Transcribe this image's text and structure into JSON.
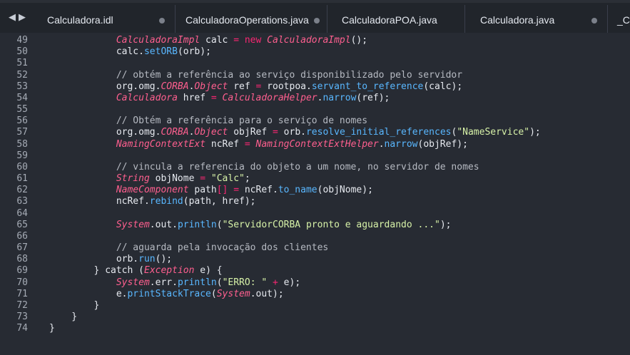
{
  "tabs": [
    {
      "label": "Calculadora.idl",
      "dirty": true
    },
    {
      "label": "CalculadoraOperations.java",
      "dirty": true
    },
    {
      "label": "CalculadoraPOA.java",
      "dirty": false
    },
    {
      "label": "Calculadora.java",
      "dirty": true
    },
    {
      "label": "_Ca",
      "dirty": false
    }
  ],
  "navigation": {
    "back_icon": "◀",
    "forward_icon": "▶"
  },
  "code_lines": [
    {
      "number": "49",
      "indent": 12,
      "tokens": [
        {
          "text": "CalculadoraImpl",
          "type": "type"
        },
        {
          "text": " calc ",
          "type": "plain"
        },
        {
          "text": "=",
          "type": "op"
        },
        {
          "text": " new ",
          "type": "keyword"
        },
        {
          "text": "CalculadoraImpl",
          "type": "type"
        },
        {
          "text": "();",
          "type": "plain"
        }
      ]
    },
    {
      "number": "50",
      "indent": 12,
      "tokens": [
        {
          "text": "calc.",
          "type": "plain"
        },
        {
          "text": "setORB",
          "type": "method"
        },
        {
          "text": "(orb);",
          "type": "plain"
        }
      ]
    },
    {
      "number": "51",
      "indent": 0,
      "tokens": []
    },
    {
      "number": "52",
      "indent": 12,
      "tokens": [
        {
          "text": "// obtém a referência ao serviço disponibilizado pelo servidor",
          "type": "comment"
        }
      ]
    },
    {
      "number": "53",
      "indent": 12,
      "tokens": [
        {
          "text": "org.omg.",
          "type": "plain"
        },
        {
          "text": "CORBA",
          "type": "type"
        },
        {
          "text": ".",
          "type": "plain"
        },
        {
          "text": "Object",
          "type": "type"
        },
        {
          "text": " ref ",
          "type": "plain"
        },
        {
          "text": "=",
          "type": "op"
        },
        {
          "text": " rootpoa.",
          "type": "plain"
        },
        {
          "text": "servant_to_reference",
          "type": "method"
        },
        {
          "text": "(calc);",
          "type": "plain"
        }
      ]
    },
    {
      "number": "54",
      "indent": 12,
      "tokens": [
        {
          "text": "Calculadora",
          "type": "type"
        },
        {
          "text": " href ",
          "type": "plain"
        },
        {
          "text": "=",
          "type": "op"
        },
        {
          "text": " ",
          "type": "plain"
        },
        {
          "text": "CalculadoraHelper",
          "type": "type"
        },
        {
          "text": ".",
          "type": "plain"
        },
        {
          "text": "narrow",
          "type": "method"
        },
        {
          "text": "(ref);",
          "type": "plain"
        }
      ]
    },
    {
      "number": "55",
      "indent": 0,
      "tokens": []
    },
    {
      "number": "56",
      "indent": 12,
      "tokens": [
        {
          "text": "// Obtém a referência para o serviço de nomes",
          "type": "comment"
        }
      ]
    },
    {
      "number": "57",
      "indent": 12,
      "tokens": [
        {
          "text": "org.omg.",
          "type": "plain"
        },
        {
          "text": "CORBA",
          "type": "type"
        },
        {
          "text": ".",
          "type": "plain"
        },
        {
          "text": "Object",
          "type": "type"
        },
        {
          "text": " objRef ",
          "type": "plain"
        },
        {
          "text": "=",
          "type": "op"
        },
        {
          "text": " orb.",
          "type": "plain"
        },
        {
          "text": "resolve_initial_references",
          "type": "method"
        },
        {
          "text": "(",
          "type": "plain"
        },
        {
          "text": "\"NameService\"",
          "type": "string"
        },
        {
          "text": ");",
          "type": "plain"
        }
      ]
    },
    {
      "number": "58",
      "indent": 12,
      "tokens": [
        {
          "text": "NamingContextExt",
          "type": "type"
        },
        {
          "text": " ncRef ",
          "type": "plain"
        },
        {
          "text": "=",
          "type": "op"
        },
        {
          "text": " ",
          "type": "plain"
        },
        {
          "text": "NamingContextExtHelper",
          "type": "type"
        },
        {
          "text": ".",
          "type": "plain"
        },
        {
          "text": "narrow",
          "type": "method"
        },
        {
          "text": "(objRef);",
          "type": "plain"
        }
      ]
    },
    {
      "number": "59",
      "indent": 0,
      "tokens": []
    },
    {
      "number": "60",
      "indent": 12,
      "tokens": [
        {
          "text": "// vincula a referencia do objeto a um nome, no servidor de nomes",
          "type": "comment"
        }
      ]
    },
    {
      "number": "61",
      "indent": 12,
      "tokens": [
        {
          "text": "String",
          "type": "type"
        },
        {
          "text": " objNome ",
          "type": "plain"
        },
        {
          "text": "=",
          "type": "op"
        },
        {
          "text": " ",
          "type": "plain"
        },
        {
          "text": "\"Calc\"",
          "type": "string"
        },
        {
          "text": ";",
          "type": "plain"
        }
      ]
    },
    {
      "number": "62",
      "indent": 12,
      "tokens": [
        {
          "text": "NameComponent",
          "type": "type"
        },
        {
          "text": " path",
          "type": "plain"
        },
        {
          "text": "[]",
          "type": "bracket"
        },
        {
          "text": " ",
          "type": "plain"
        },
        {
          "text": "=",
          "type": "op"
        },
        {
          "text": " ncRef.",
          "type": "plain"
        },
        {
          "text": "to_name",
          "type": "method"
        },
        {
          "text": "(objNome);",
          "type": "plain"
        }
      ]
    },
    {
      "number": "63",
      "indent": 12,
      "tokens": [
        {
          "text": "ncRef.",
          "type": "plain"
        },
        {
          "text": "rebind",
          "type": "method"
        },
        {
          "text": "(path, href);",
          "type": "plain"
        }
      ]
    },
    {
      "number": "64",
      "indent": 0,
      "tokens": []
    },
    {
      "number": "65",
      "indent": 12,
      "tokens": [
        {
          "text": "System",
          "type": "type"
        },
        {
          "text": ".out.",
          "type": "plain"
        },
        {
          "text": "println",
          "type": "method"
        },
        {
          "text": "(",
          "type": "plain"
        },
        {
          "text": "\"ServidorCORBA pronto e aguardando ...\"",
          "type": "string"
        },
        {
          "text": ");",
          "type": "plain"
        }
      ]
    },
    {
      "number": "66",
      "indent": 0,
      "tokens": []
    },
    {
      "number": "67",
      "indent": 12,
      "tokens": [
        {
          "text": "// aguarda pela invocação dos clientes",
          "type": "comment"
        }
      ]
    },
    {
      "number": "68",
      "indent": 12,
      "tokens": [
        {
          "text": "orb.",
          "type": "plain"
        },
        {
          "text": "run",
          "type": "method"
        },
        {
          "text": "();",
          "type": "plain"
        }
      ]
    },
    {
      "number": "69",
      "indent": 8,
      "tokens": [
        {
          "text": "} ",
          "type": "plain"
        },
        {
          "text": "catch",
          "type": "keyword-soft"
        },
        {
          "text": " (",
          "type": "plain"
        },
        {
          "text": "Exception",
          "type": "type"
        },
        {
          "text": " e) {",
          "type": "plain"
        }
      ]
    },
    {
      "number": "70",
      "indent": 12,
      "tokens": [
        {
          "text": "System",
          "type": "type"
        },
        {
          "text": ".err.",
          "type": "plain"
        },
        {
          "text": "println",
          "type": "method"
        },
        {
          "text": "(",
          "type": "plain"
        },
        {
          "text": "\"ERRO: \"",
          "type": "string"
        },
        {
          "text": " ",
          "type": "plain"
        },
        {
          "text": "+",
          "type": "op"
        },
        {
          "text": " e);",
          "type": "plain"
        }
      ]
    },
    {
      "number": "71",
      "indent": 12,
      "tokens": [
        {
          "text": "e.",
          "type": "plain"
        },
        {
          "text": "printStackTrace",
          "type": "method"
        },
        {
          "text": "(",
          "type": "plain"
        },
        {
          "text": "System",
          "type": "type"
        },
        {
          "text": ".out);",
          "type": "plain"
        }
      ]
    },
    {
      "number": "72",
      "indent": 8,
      "tokens": [
        {
          "text": "}",
          "type": "plain"
        }
      ]
    },
    {
      "number": "73",
      "indent": 4,
      "tokens": [
        {
          "text": "}",
          "type": "plain"
        }
      ]
    },
    {
      "number": "74",
      "indent": 0,
      "tokens": [
        {
          "text": "}",
          "type": "plain"
        }
      ]
    }
  ],
  "colors": {
    "background": "#272b33",
    "tab_background": "#21252b",
    "line_number": "#a5abb5",
    "text": "#e6e9ef",
    "keyword": "#f92672",
    "type": "#ff5f8f",
    "method": "#59b7ff",
    "string": "#d7f2a8",
    "comment": "#b6bac2"
  }
}
